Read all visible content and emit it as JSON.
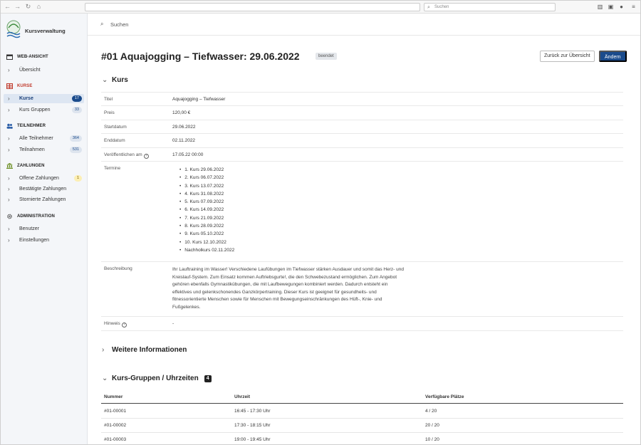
{
  "browser": {
    "search_placeholder": "Suchen"
  },
  "sidebar": {
    "brand": "Kursverwaltung",
    "sections": [
      {
        "label": "WEB-ANSICHT",
        "color": "#333333",
        "items": [
          {
            "label": "Übersicht"
          }
        ]
      },
      {
        "label": "KURSE",
        "color": "#c0392b",
        "items": [
          {
            "label": "Kurse",
            "count": "17",
            "active": true
          },
          {
            "label": "Kurs Gruppen",
            "count": "33"
          }
        ]
      },
      {
        "label": "TEILNEHMER",
        "color": "#333333",
        "items": [
          {
            "label": "Alle Teilnehmer",
            "count": "364"
          },
          {
            "label": "Teilnahmen",
            "count": "531"
          }
        ]
      },
      {
        "label": "ZAHLUNGEN",
        "color": "#333333",
        "items": [
          {
            "label": "Offene Zahlungen",
            "count": "1"
          },
          {
            "label": "Bestätigte Zahlungen"
          },
          {
            "label": "Stornierte Zahlungen"
          }
        ]
      },
      {
        "label": "ADMINISTRATION",
        "color": "#333333",
        "items": [
          {
            "label": "Benutzer"
          },
          {
            "label": "Einstellungen"
          }
        ]
      }
    ]
  },
  "main": {
    "search_label": "Suchen",
    "title": "#01 Aquajogging – Tiefwasser: 29.06.2022",
    "status_badge": "beendet",
    "back_button": "Zurück zur Übersicht",
    "edit_button": "Ändern",
    "section_kurs": "Kurs",
    "details": {
      "titel_label": "Titel",
      "titel": "Aquajogging – Tiefwasser",
      "preis_label": "Preis",
      "preis": "120,00 €",
      "start_label": "Startdatum",
      "start": "29.06.2022",
      "end_label": "Enddatum",
      "end": "02.11.2022",
      "pub_label": "Veröffentlichen am",
      "pub": "17.05.22 00:00",
      "termine_label": "Termine",
      "termine": [
        "1. Kurs 29.06.2022",
        "2. Kurs 06.07.2022",
        "3. Kurs 13.07.2022",
        "4. Kurs 31.08.2022",
        "5. Kurs 07.09.2022",
        "6. Kurs 14.09.2022",
        "7. Kurs 21.09.2022",
        "8. Kurs 28.09.2022",
        "9. Kurs 05.10.2022",
        "10. Kurs 12.10.2022",
        "Nachholkurs 02.11.2022"
      ],
      "beschreibung_label": "Beschreibung",
      "beschreibung": "Ihr Lauftraining im Wasser! Verschiedene Laufübungen im Tiefwasser stärken Ausdauer und somit das Herz- und Kreislauf-System. Zum Einsatz kommen Auftriebsgurte!, die den Schwebezustand ermöglichen. Zum Angebot gehören ebenfalls Gymnastikübungen, die mit Laufbewegungen kombiniert werden. Dadurch entsteht ein effektives und gelenkschonendes Ganzkörpertraining. Dieser Kurs ist geeignet für gesundheits- und fitnessorientierte Menschen sowie für Menschen mit Bewegungseinschränkungen des Hüft-, Knie- und Fußgelenkes.",
      "hinweis_label": "Hinweis",
      "hinweis": "-"
    },
    "section_more": "Weitere Informationen",
    "section_groups": "Kurs-Gruppen / Uhrzeiten",
    "groups_count": "4",
    "groups_table": {
      "headers": [
        "Nummer",
        "Uhrzeit",
        "Verfügbare Plätze"
      ],
      "rows": [
        [
          "#01-00001",
          "16:45 - 17:30 Uhr",
          "4 / 20"
        ],
        [
          "#01-00002",
          "17:30 - 18:15 Uhr",
          "20 / 20"
        ],
        [
          "#01-00003",
          "19:00 - 19:45 Uhr",
          "10 / 20"
        ]
      ]
    }
  }
}
